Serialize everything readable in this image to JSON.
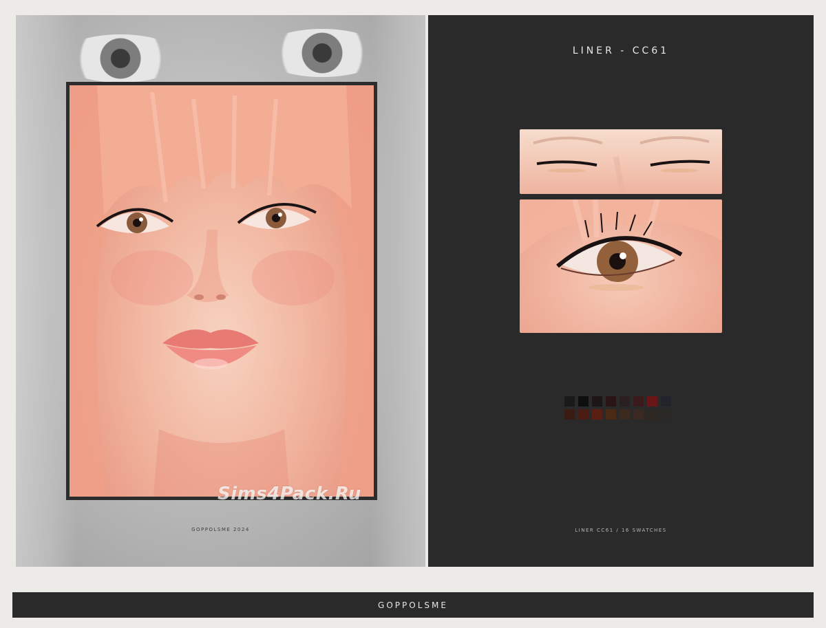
{
  "left_panel": {
    "caption": "GOPPOLSME 2024",
    "watermark": "Sims4Pack.Ru"
  },
  "right_panel": {
    "title": "LINER - CC61",
    "caption": "LINER CC61 / 16 SWATCHES",
    "swatches": [
      "#1a1a1a",
      "#0f0f0f",
      "#1c1716",
      "#2a1416",
      "#2b2020",
      "#3a1a1c",
      "#6a1517",
      "#22242c",
      "#3a1c14",
      "#4a1c14",
      "#5a1e12",
      "#4a2a14",
      "#3a2a20",
      "#3a2a22",
      "#2e2722",
      "#2b2926"
    ]
  },
  "footer": {
    "brand": "GOPPOLSME"
  },
  "colors": {
    "page_background": "#ecebe7",
    "panel_dark": "#2a2a2a",
    "skin_accent": "#f1b6a0"
  }
}
